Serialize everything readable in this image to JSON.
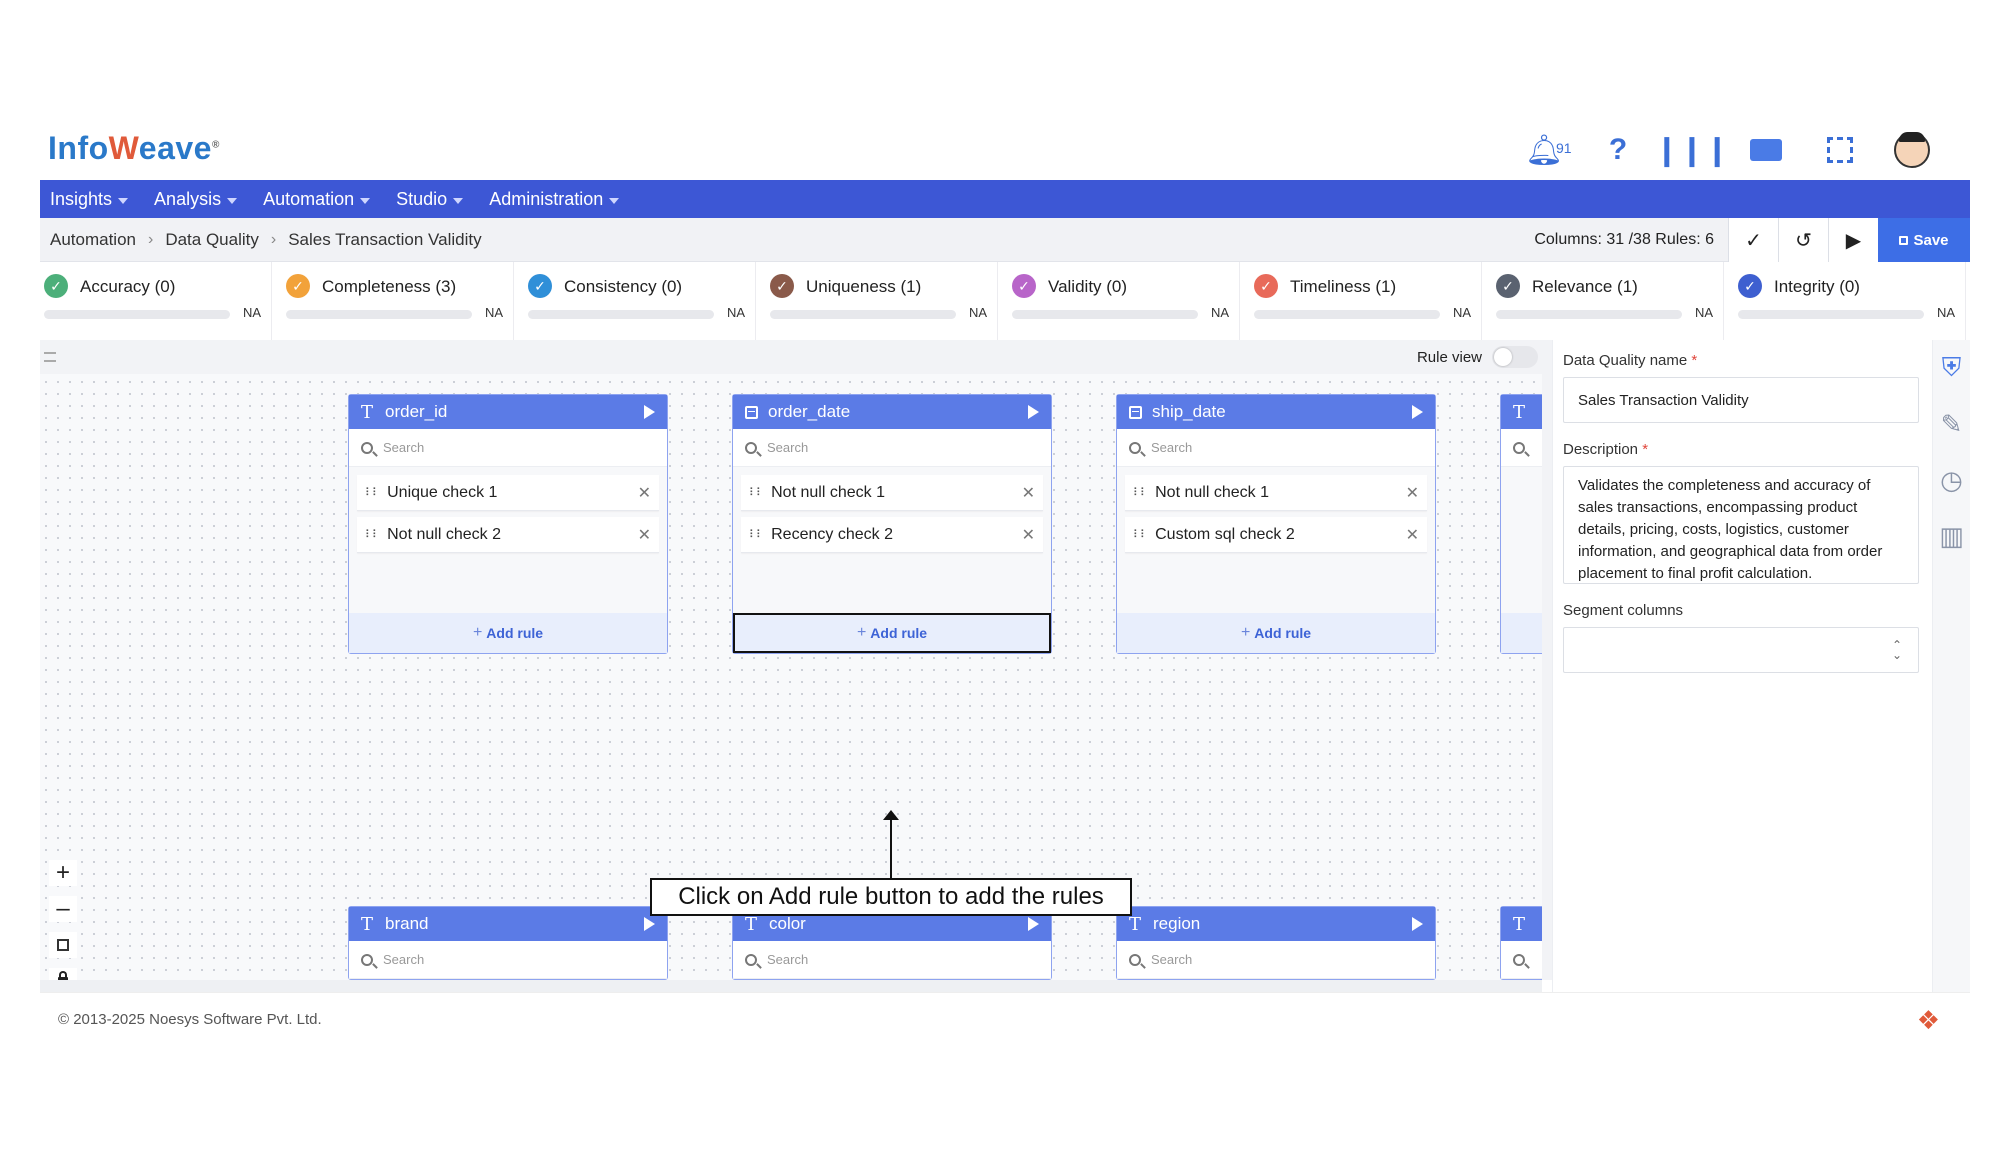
{
  "logo": {
    "prefix": "Info",
    "mark": "W",
    "suffix": "eave",
    "reg": "®"
  },
  "header": {
    "notification_count": "91"
  },
  "nav": [
    "Insights",
    "Analysis",
    "Automation",
    "Studio",
    "Administration"
  ],
  "breadcrumb": [
    "Automation",
    "Data Quality",
    "Sales Transaction Validity"
  ],
  "toolbar": {
    "counts": "Columns: 31 /38  Rules: 6",
    "save_label": "Save"
  },
  "metrics": [
    {
      "label": "Accuracy (0)",
      "value": "NA",
      "color": "#4caf7a",
      "icon": "check-circle-icon"
    },
    {
      "label": "Completeness (3)",
      "value": "NA",
      "color": "#f2a23a",
      "icon": "slash-circle-icon"
    },
    {
      "label": "Consistency (0)",
      "value": "NA",
      "color": "#2f8fd8",
      "icon": "refresh-icon"
    },
    {
      "label": "Uniqueness (1)",
      "value": "NA",
      "color": "#8a5a4a",
      "icon": "fingerprint-icon"
    },
    {
      "label": "Validity (0)",
      "value": "NA",
      "color": "#b865c9",
      "icon": "checkbox-icon"
    },
    {
      "label": "Timeliness (1)",
      "value": "NA",
      "color": "#e86a5a",
      "icon": "clock-icon"
    },
    {
      "label": "Relevance (1)",
      "value": "NA",
      "color": "#5a6270",
      "icon": "lock-icon"
    },
    {
      "label": "Integrity (0)",
      "value": "NA",
      "color": "#3e5fd0",
      "icon": "link-icon"
    }
  ],
  "canvas": {
    "rule_view_label": "Rule view",
    "search_placeholder": "Search",
    "add_rule_label": "Add rule"
  },
  "cards": [
    {
      "name": "order_id",
      "type": "text",
      "rules": [
        "Unique check 1",
        "Not null check 2"
      ]
    },
    {
      "name": "order_date",
      "type": "date",
      "rules": [
        "Not null check 1",
        "Recency check 2"
      ]
    },
    {
      "name": "ship_date",
      "type": "date",
      "rules": [
        "Not null check 1",
        "Custom sql check 2"
      ]
    },
    {
      "name": "brand",
      "type": "text",
      "rules": []
    },
    {
      "name": "color",
      "type": "text",
      "rules": []
    },
    {
      "name": "region",
      "type": "text",
      "rules": []
    }
  ],
  "callout": "Click on Add rule button to add the rules",
  "panel": {
    "name_label": "Data Quality name",
    "name_value": "Sales Transaction Validity",
    "desc_label": "Description",
    "desc_value": "Validates the completeness and accuracy of sales transactions, encompassing product details, pricing, costs, logistics, customer information, and geographical data from order placement to final profit calculation.",
    "segment_label": "Segment columns",
    "required_mark": "*"
  },
  "footer": {
    "copyright": "© 2013-2025 Noesys Software Pvt. Ltd."
  }
}
